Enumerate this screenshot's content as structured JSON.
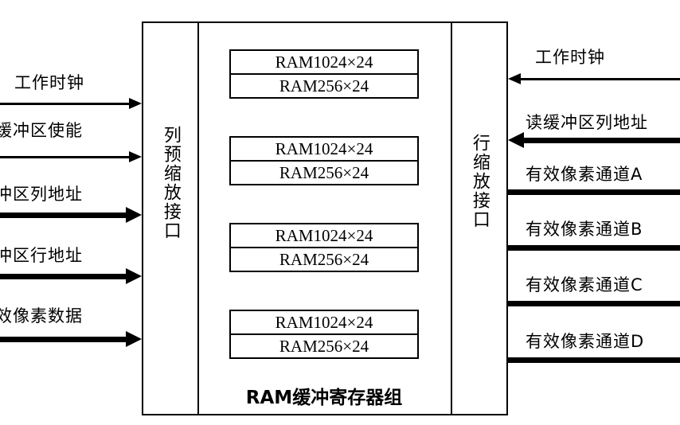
{
  "diagram": {
    "module": {
      "column_interface_label": "列预缩放接口",
      "row_interface_label": "行缩放接口",
      "ram_caption": "RAM缓冲寄存器组"
    },
    "ram_groups": [
      {
        "top_label": "RAM1024×24",
        "bottom_label": "RAM256×24"
      },
      {
        "top_label": "RAM1024×24",
        "bottom_label": "RAM256×24"
      },
      {
        "top_label": "RAM1024×24",
        "bottom_label": "RAM256×24"
      },
      {
        "top_label": "RAM1024×24",
        "bottom_label": "RAM256×24"
      }
    ],
    "left_signals": [
      {
        "label": "工作时钟"
      },
      {
        "label": "缓冲区使能"
      },
      {
        "label": "冲区列地址"
      },
      {
        "label": "冲区行地址"
      },
      {
        "label": "效像素数据"
      }
    ],
    "right_signals": [
      {
        "label": "工作时钟"
      },
      {
        "label": "读缓冲区列地址"
      },
      {
        "label": "有效像素通道A"
      },
      {
        "label": "有效像素通道B"
      },
      {
        "label": "有效像素通道C"
      },
      {
        "label": "有效像素通道D"
      }
    ]
  }
}
